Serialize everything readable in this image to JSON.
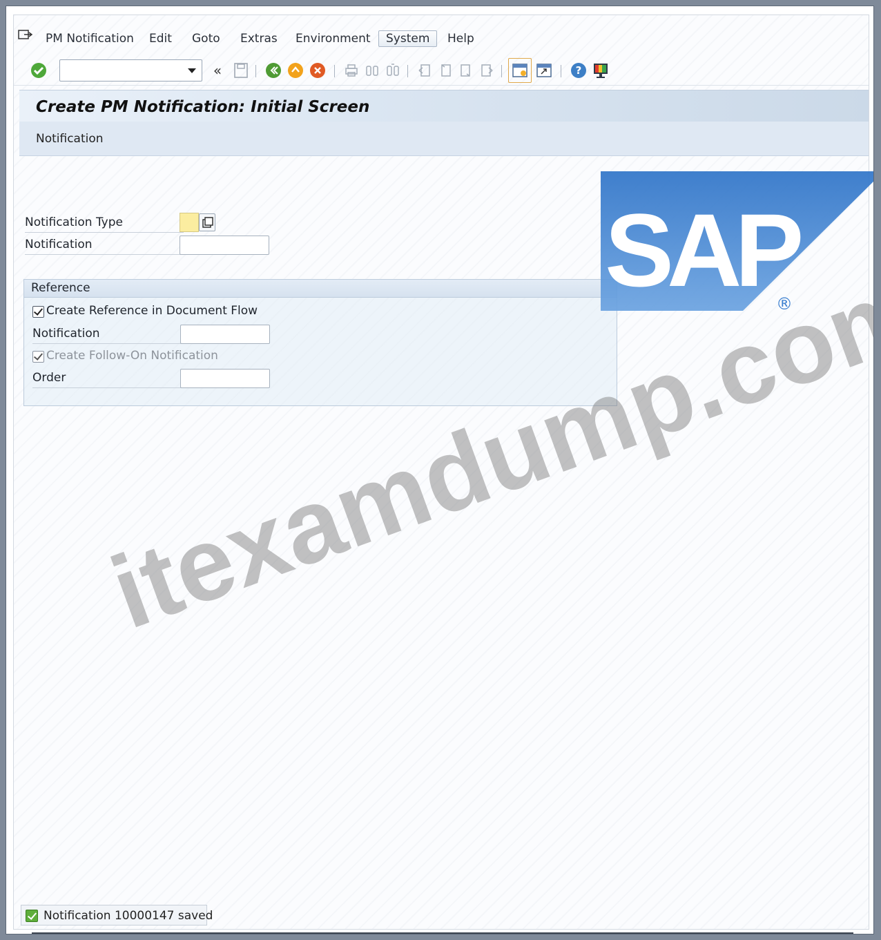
{
  "menubar": {
    "items": [
      "PM Notification",
      "Edit",
      "Goto",
      "Extras",
      "Environment",
      "System",
      "Help"
    ],
    "active": "System"
  },
  "toolbar": {
    "command_field_value": "",
    "icons": [
      "enter-icon",
      "back-nav-icon",
      "save-icon",
      "back-icon",
      "exit-icon",
      "cancel-icon",
      "print-icon",
      "find-icon",
      "find-next-icon",
      "first-page-icon",
      "previous-page-icon",
      "next-page-icon",
      "last-page-icon",
      "new-session-icon",
      "shortcut-icon",
      "help-icon",
      "customize-layout-icon"
    ]
  },
  "page": {
    "title": "Create PM Notification: Initial Screen",
    "app_toolbar_item": "Notification"
  },
  "form": {
    "notification_type_label": "Notification Type",
    "notification_type_value": "",
    "notification_label": "Notification",
    "notification_value": ""
  },
  "reference": {
    "title": "Reference",
    "create_reference_label": "Create Reference in Document Flow",
    "create_reference_checked": true,
    "notification_label": "Notification",
    "notification_value": "",
    "follow_on_label": "Create Follow-On Notification",
    "follow_on_checked": true,
    "order_label": "Order",
    "order_value": ""
  },
  "status": {
    "message": "Notification 10000147 saved",
    "type": "success"
  },
  "watermark": {
    "logo_text": "SAP",
    "site_text": "itexamdump.com"
  },
  "colors": {
    "required_field": "#fbeda0",
    "title_band": "#dbe6f2",
    "sap_blue": "#3b7fd0",
    "success": "#5fae3b"
  }
}
